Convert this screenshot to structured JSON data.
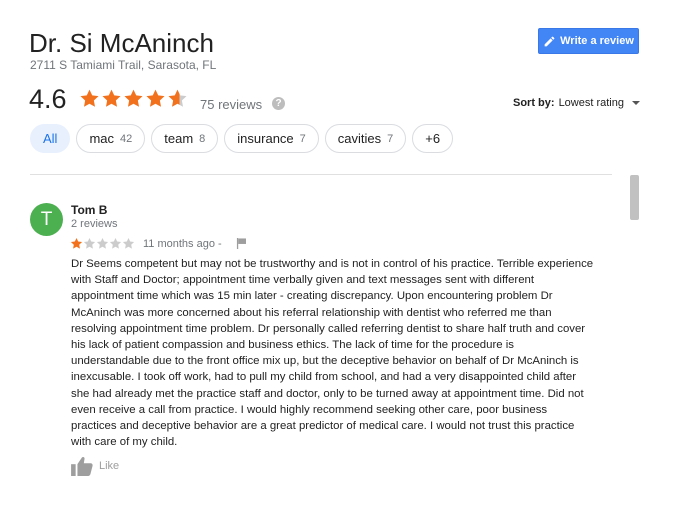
{
  "header": {
    "title": "Dr. Si McAninch",
    "address": "2711 S Tamiami Trail, Sarasota, FL",
    "write_review_label": "Write a review"
  },
  "summary": {
    "rating": "4.6",
    "rating_value": 4.6,
    "reviews_count_label": "75 reviews",
    "help_symbol": "?"
  },
  "sort": {
    "label": "Sort by:",
    "value": "Lowest rating"
  },
  "chips": [
    {
      "label": "All",
      "count": "",
      "active": true
    },
    {
      "label": "mac",
      "count": "42",
      "active": false
    },
    {
      "label": "team",
      "count": "8",
      "active": false
    },
    {
      "label": "insurance",
      "count": "7",
      "active": false
    },
    {
      "label": "cavities",
      "count": "7",
      "active": false
    },
    {
      "label": "+6",
      "count": "",
      "active": false
    }
  ],
  "review": {
    "avatar_letter": "T",
    "author": "Tom B",
    "author_sub": "2 reviews",
    "stars": 1,
    "time": "11 months ago -",
    "text": "Dr Seems competent but may not be trustworthy and is not in control of his practice.  Terrible experience\nwith Staff and Doctor; appointment time verbally given and text messages sent with different\nappointment time which was 15 min later - creating discrepancy.  Upon encountering problem Dr\nMcAninch was more concerned about his referral relationship with dentist who referred me than\nresolving appointment time problem.  Dr personally called referring dentist to share half truth and cover\nhis lack of patient compassion and business ethics.  The lack of time for the procedure is\nunderstandable due to the front office mix up, but the deceptive behavior on behalf of Dr McAninch is\ninexcusable.  I took off work, had to pull my child from school, and had a very disappointed child after\nshe had already met the practice staff and doctor, only to be turned away at appointment time.   Did not\neven receive a call from practice.  I would highly recommend seeking other care, poor business\npractices and deceptive behavior are a great predictor of medical care.  I would not trust this practice\nwith care of my child.",
    "like_label": "Like"
  },
  "colors": {
    "star_filled": "#f2711c",
    "star_empty": "#cccccc",
    "accent": "#4285f4",
    "avatar": "#4caf50"
  }
}
